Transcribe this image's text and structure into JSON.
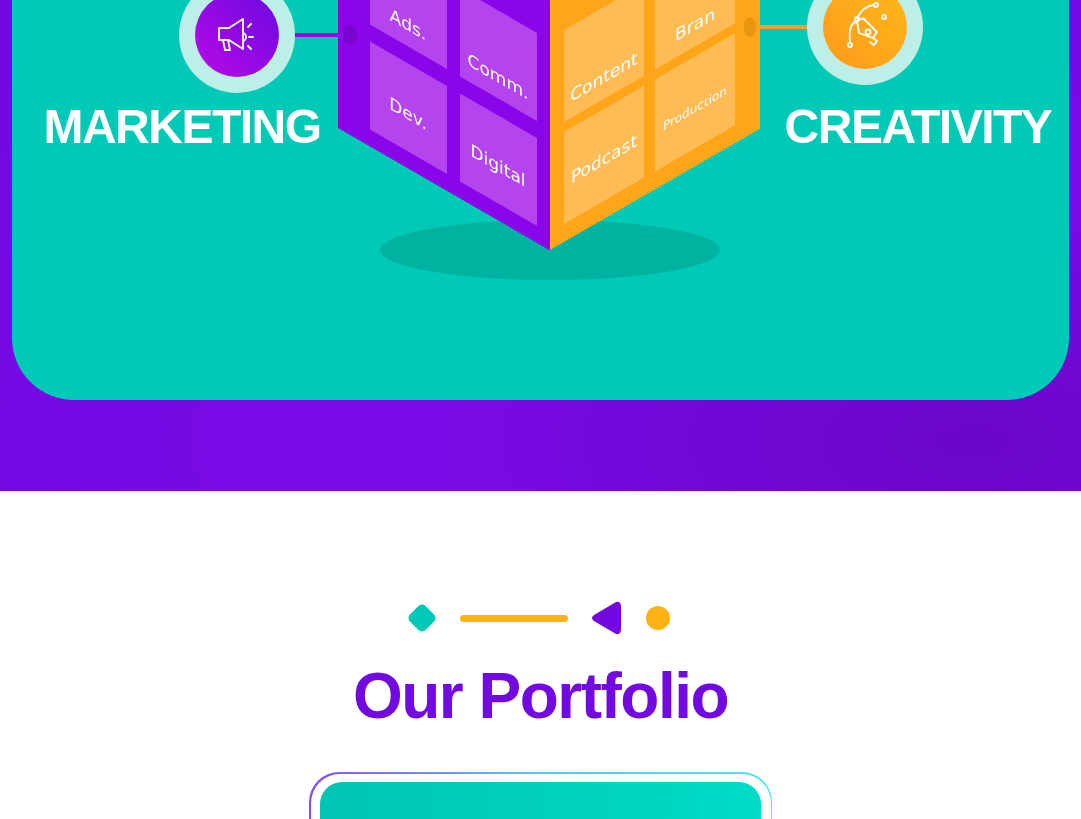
{
  "hero": {
    "features": [
      {
        "kind": "marketing",
        "label": "MARKETING"
      },
      {
        "kind": "creativity",
        "label": "CREATIVITY"
      }
    ],
    "cube": {
      "left_face": [
        "Ads.",
        "Comm.",
        "Dev.",
        "Digital"
      ],
      "right_face": [
        "Content",
        "Bran",
        "Podcast",
        "Production"
      ]
    }
  },
  "portfolio": {
    "title": "Our Portfolio"
  }
}
